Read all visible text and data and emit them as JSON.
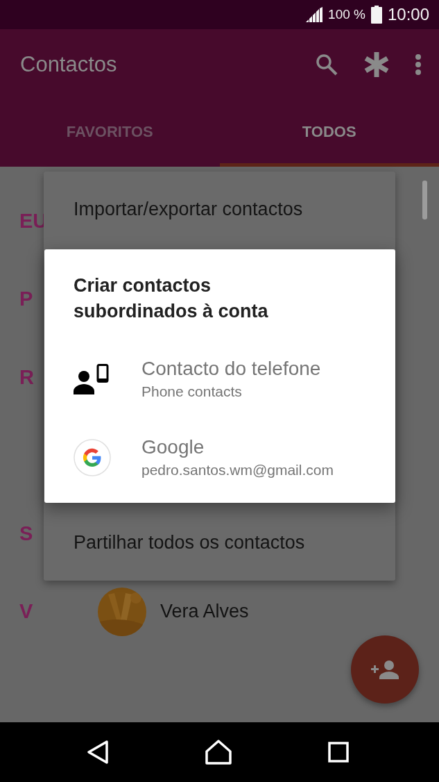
{
  "status_bar": {
    "battery": "100 %",
    "time": "10:00"
  },
  "app_bar": {
    "title": "Contactos"
  },
  "tabs": [
    {
      "label": "FAVORITOS",
      "selected": false
    },
    {
      "label": "TODOS",
      "selected": true
    }
  ],
  "contacts": [
    {
      "letter": "EU"
    },
    {
      "letter": "P"
    },
    {
      "letter": "R"
    },
    {
      "letter": "S"
    },
    {
      "letter": "V",
      "name": "Vera Alves"
    }
  ],
  "menu": {
    "items": [
      "Importar/exportar contactos",
      "Partilhar todos os contactos"
    ]
  },
  "dialog": {
    "title": "Criar contactos subordinados à conta",
    "options": [
      {
        "kind": "phone",
        "label": "Contacto do telefone",
        "account": "Phone contacts"
      },
      {
        "kind": "google",
        "label": "Google",
        "account": "pedro.santos.wm@gmail.com"
      }
    ]
  }
}
